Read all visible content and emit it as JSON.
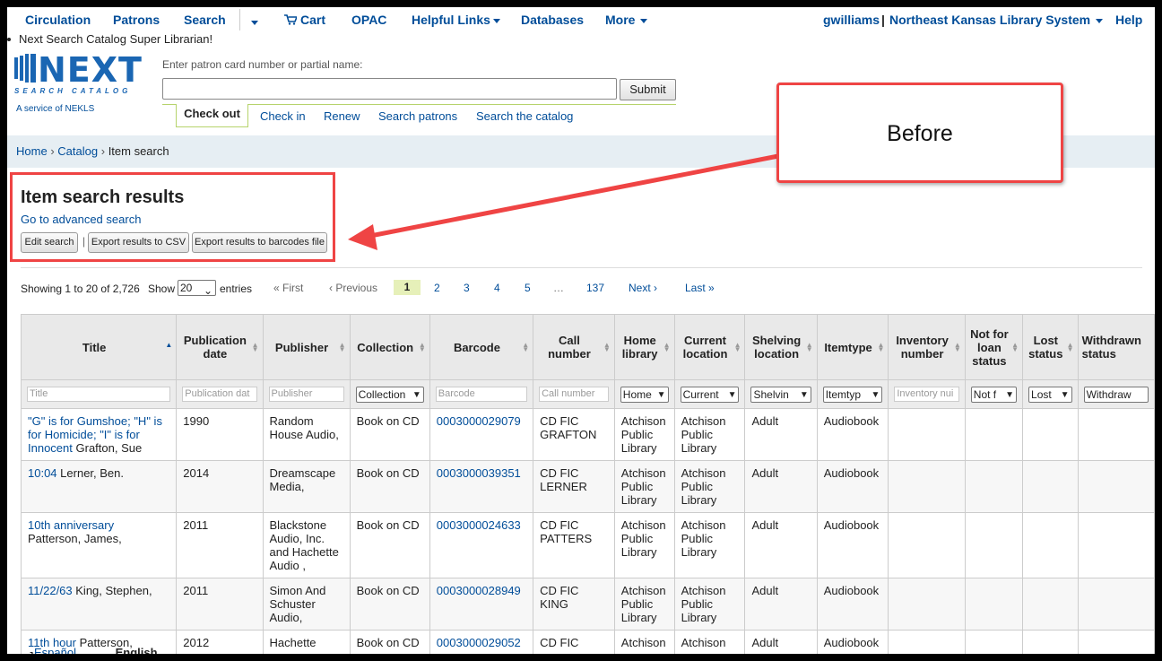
{
  "nav": {
    "circulation": "Circulation",
    "patrons": "Patrons",
    "search": "Search",
    "cart": "Cart",
    "opac": "OPAC",
    "helpful_links": "Helpful Links",
    "databases": "Databases",
    "more": "More",
    "user": "gwilliams",
    "separator": "|",
    "library": "Northeast Kansas Library System",
    "help": "Help"
  },
  "message": "Next Search Catalog Super Librarian!",
  "logo": {
    "word": "NEXT",
    "sub": "SEARCH CATALOG",
    "service": "A service of NEKLS"
  },
  "patron_search": {
    "label": "Enter patron card number or partial name:",
    "value": "",
    "submit": "Submit",
    "tabs": [
      "Check out",
      "Check in",
      "Renew",
      "Search patrons",
      "Search the catalog"
    ]
  },
  "breadcrumb": {
    "home": "Home",
    "catalog": "Catalog",
    "current": "Item search",
    "sep": "›"
  },
  "results": {
    "title": "Item search results",
    "advanced_link": "Go to advanced search",
    "edit_search": "Edit search",
    "divider": "|",
    "export_csv": "Export results to CSV",
    "export_barcodes": "Export results to barcodes file"
  },
  "callout": {
    "text": "Before",
    "color": "#ef4444"
  },
  "pager": {
    "showing": "Showing 1 to 20 of 2,726",
    "show_label": "Show",
    "show_value": "20",
    "entries": "entries",
    "first": "« First",
    "previous": "‹ Previous",
    "current": "1",
    "pages": [
      "2",
      "3",
      "4",
      "5"
    ],
    "ellipsis": "…",
    "last_page": "137",
    "next": "Next ›",
    "last": "Last »"
  },
  "table": {
    "headers": [
      "Title",
      "Publication date",
      "Publisher",
      "Collection",
      "Barcode",
      "Call number",
      "Home library",
      "Current location",
      "Shelving location",
      "Itemtype",
      "Inventory number",
      "Not for loan status",
      "Lost status",
      "Withdrawn status"
    ],
    "filters": {
      "title": "Title",
      "pubdate": "Publication dat",
      "publisher": "Publisher",
      "collection": "Collection",
      "barcode": "Barcode",
      "callnumber": "Call number",
      "homelib": "Home",
      "curloc": "Current",
      "shelving": "Shelvin",
      "itemtype": "Itemtyp",
      "inventory": "Inventory nui",
      "notforloan": "Not f",
      "lost": "Lost",
      "withdrawn": "Withdraw"
    },
    "rows": [
      {
        "title_link": "\"G\" is for Gumshoe; \"H\" is for Homicide; \"I\" is for Innocent",
        "author": "Grafton, Sue",
        "pubdate": "1990",
        "publisher": "Random House Audio,",
        "collection": "Book on CD",
        "barcode": "0003000029079",
        "callnumber": "CD FIC GRAFTON",
        "homelib": "Atchison Public Library",
        "curloc": "Atchison Public Library",
        "shelving": "Adult",
        "itemtype": "Audiobook"
      },
      {
        "title_link": "10:04",
        "author": "Lerner, Ben.",
        "pubdate": "2014",
        "publisher": "Dreamscape Media,",
        "collection": "Book on CD",
        "barcode": "0003000039351",
        "callnumber": "CD FIC LERNER",
        "homelib": "Atchison Public Library",
        "curloc": "Atchison Public Library",
        "shelving": "Adult",
        "itemtype": "Audiobook"
      },
      {
        "title_link": "10th anniversary",
        "author": "Patterson, James,",
        "pubdate": "2011",
        "publisher": "Blackstone Audio, Inc. and Hachette Audio ,",
        "collection": "Book on CD",
        "barcode": "0003000024633",
        "callnumber": "CD FIC PATTERS",
        "homelib": "Atchison Public Library",
        "curloc": "Atchison Public Library",
        "shelving": "Adult",
        "itemtype": "Audiobook"
      },
      {
        "title_link": "11/22/63",
        "author": "King, Stephen,",
        "pubdate": "2011",
        "publisher": "Simon And Schuster Audio,",
        "collection": "Book on CD",
        "barcode": "0003000028949",
        "callnumber": "CD FIC KING",
        "homelib": "Atchison Public Library",
        "curloc": "Atchison Public Library",
        "shelving": "Adult",
        "itemtype": "Audiobook"
      },
      {
        "title_link": "11th hour",
        "author": "Patterson, James",
        "pubdate": "2012",
        "publisher": "Hachette",
        "collection": "Book on CD",
        "barcode": "0003000029052",
        "callnumber": "CD FIC",
        "homelib": "Atchison",
        "curloc": "Atchison",
        "shelving": "Adult",
        "itemtype": "Audiobook"
      }
    ]
  },
  "languages": {
    "espanol": "Español",
    "english": "English"
  }
}
